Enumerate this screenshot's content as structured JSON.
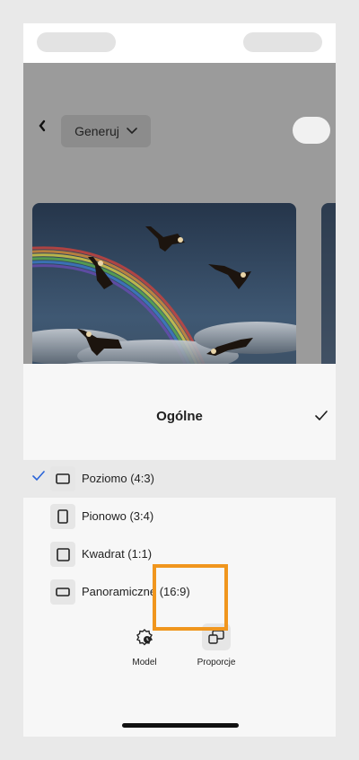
{
  "header": {
    "back_icon": "chevron-left-icon",
    "generate_label": "Generuj",
    "generate_icon": "chevron-down-icon"
  },
  "sheet": {
    "title": "Ogólne",
    "confirm_icon": "checkmark-icon",
    "options": [
      {
        "label": "Poziomo (4:3)",
        "icon": "landscape-icon",
        "selected": true
      },
      {
        "label": "Pionowo (3:4)",
        "icon": "portrait-icon",
        "selected": false
      },
      {
        "label": "Kwadrat (1:1)",
        "icon": "square-icon",
        "selected": false
      },
      {
        "label": "Panoramiczne (16:9)",
        "icon": "widescreen-icon",
        "selected": false
      }
    ]
  },
  "toolbar": {
    "model_label": "Model",
    "aspect_label": "Proporcje",
    "active_tool": "Proporcje"
  },
  "colors": {
    "highlight": "#f0961e",
    "selection_check": "#2a64d8",
    "dim_overlay": "#9b9b9b"
  }
}
